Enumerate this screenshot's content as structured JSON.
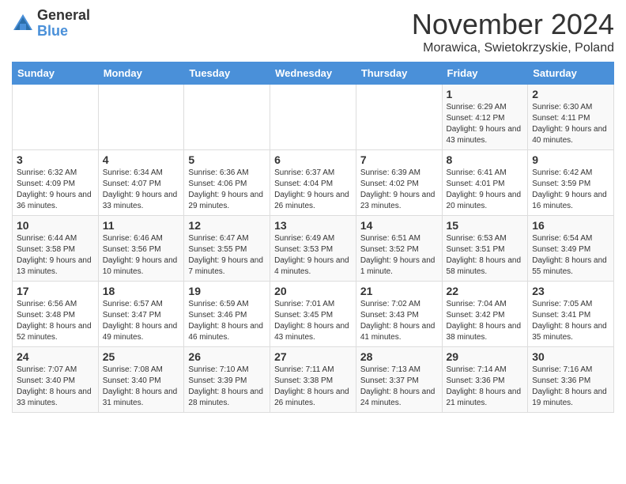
{
  "logo": {
    "general": "General",
    "blue": "Blue"
  },
  "header": {
    "month": "November 2024",
    "location": "Morawica, Swietokrzyskie, Poland"
  },
  "weekdays": [
    "Sunday",
    "Monday",
    "Tuesday",
    "Wednesday",
    "Thursday",
    "Friday",
    "Saturday"
  ],
  "weeks": [
    [
      {
        "day": "",
        "sunrise": "",
        "sunset": "",
        "daylight": ""
      },
      {
        "day": "",
        "sunrise": "",
        "sunset": "",
        "daylight": ""
      },
      {
        "day": "",
        "sunrise": "",
        "sunset": "",
        "daylight": ""
      },
      {
        "day": "",
        "sunrise": "",
        "sunset": "",
        "daylight": ""
      },
      {
        "day": "",
        "sunrise": "",
        "sunset": "",
        "daylight": ""
      },
      {
        "day": "1",
        "sunrise": "Sunrise: 6:29 AM",
        "sunset": "Sunset: 4:12 PM",
        "daylight": "Daylight: 9 hours and 43 minutes."
      },
      {
        "day": "2",
        "sunrise": "Sunrise: 6:30 AM",
        "sunset": "Sunset: 4:11 PM",
        "daylight": "Daylight: 9 hours and 40 minutes."
      }
    ],
    [
      {
        "day": "3",
        "sunrise": "Sunrise: 6:32 AM",
        "sunset": "Sunset: 4:09 PM",
        "daylight": "Daylight: 9 hours and 36 minutes."
      },
      {
        "day": "4",
        "sunrise": "Sunrise: 6:34 AM",
        "sunset": "Sunset: 4:07 PM",
        "daylight": "Daylight: 9 hours and 33 minutes."
      },
      {
        "day": "5",
        "sunrise": "Sunrise: 6:36 AM",
        "sunset": "Sunset: 4:06 PM",
        "daylight": "Daylight: 9 hours and 29 minutes."
      },
      {
        "day": "6",
        "sunrise": "Sunrise: 6:37 AM",
        "sunset": "Sunset: 4:04 PM",
        "daylight": "Daylight: 9 hours and 26 minutes."
      },
      {
        "day": "7",
        "sunrise": "Sunrise: 6:39 AM",
        "sunset": "Sunset: 4:02 PM",
        "daylight": "Daylight: 9 hours and 23 minutes."
      },
      {
        "day": "8",
        "sunrise": "Sunrise: 6:41 AM",
        "sunset": "Sunset: 4:01 PM",
        "daylight": "Daylight: 9 hours and 20 minutes."
      },
      {
        "day": "9",
        "sunrise": "Sunrise: 6:42 AM",
        "sunset": "Sunset: 3:59 PM",
        "daylight": "Daylight: 9 hours and 16 minutes."
      }
    ],
    [
      {
        "day": "10",
        "sunrise": "Sunrise: 6:44 AM",
        "sunset": "Sunset: 3:58 PM",
        "daylight": "Daylight: 9 hours and 13 minutes."
      },
      {
        "day": "11",
        "sunrise": "Sunrise: 6:46 AM",
        "sunset": "Sunset: 3:56 PM",
        "daylight": "Daylight: 9 hours and 10 minutes."
      },
      {
        "day": "12",
        "sunrise": "Sunrise: 6:47 AM",
        "sunset": "Sunset: 3:55 PM",
        "daylight": "Daylight: 9 hours and 7 minutes."
      },
      {
        "day": "13",
        "sunrise": "Sunrise: 6:49 AM",
        "sunset": "Sunset: 3:53 PM",
        "daylight": "Daylight: 9 hours and 4 minutes."
      },
      {
        "day": "14",
        "sunrise": "Sunrise: 6:51 AM",
        "sunset": "Sunset: 3:52 PM",
        "daylight": "Daylight: 9 hours and 1 minute."
      },
      {
        "day": "15",
        "sunrise": "Sunrise: 6:53 AM",
        "sunset": "Sunset: 3:51 PM",
        "daylight": "Daylight: 8 hours and 58 minutes."
      },
      {
        "day": "16",
        "sunrise": "Sunrise: 6:54 AM",
        "sunset": "Sunset: 3:49 PM",
        "daylight": "Daylight: 8 hours and 55 minutes."
      }
    ],
    [
      {
        "day": "17",
        "sunrise": "Sunrise: 6:56 AM",
        "sunset": "Sunset: 3:48 PM",
        "daylight": "Daylight: 8 hours and 52 minutes."
      },
      {
        "day": "18",
        "sunrise": "Sunrise: 6:57 AM",
        "sunset": "Sunset: 3:47 PM",
        "daylight": "Daylight: 8 hours and 49 minutes."
      },
      {
        "day": "19",
        "sunrise": "Sunrise: 6:59 AM",
        "sunset": "Sunset: 3:46 PM",
        "daylight": "Daylight: 8 hours and 46 minutes."
      },
      {
        "day": "20",
        "sunrise": "Sunrise: 7:01 AM",
        "sunset": "Sunset: 3:45 PM",
        "daylight": "Daylight: 8 hours and 43 minutes."
      },
      {
        "day": "21",
        "sunrise": "Sunrise: 7:02 AM",
        "sunset": "Sunset: 3:43 PM",
        "daylight": "Daylight: 8 hours and 41 minutes."
      },
      {
        "day": "22",
        "sunrise": "Sunrise: 7:04 AM",
        "sunset": "Sunset: 3:42 PM",
        "daylight": "Daylight: 8 hours and 38 minutes."
      },
      {
        "day": "23",
        "sunrise": "Sunrise: 7:05 AM",
        "sunset": "Sunset: 3:41 PM",
        "daylight": "Daylight: 8 hours and 35 minutes."
      }
    ],
    [
      {
        "day": "24",
        "sunrise": "Sunrise: 7:07 AM",
        "sunset": "Sunset: 3:40 PM",
        "daylight": "Daylight: 8 hours and 33 minutes."
      },
      {
        "day": "25",
        "sunrise": "Sunrise: 7:08 AM",
        "sunset": "Sunset: 3:40 PM",
        "daylight": "Daylight: 8 hours and 31 minutes."
      },
      {
        "day": "26",
        "sunrise": "Sunrise: 7:10 AM",
        "sunset": "Sunset: 3:39 PM",
        "daylight": "Daylight: 8 hours and 28 minutes."
      },
      {
        "day": "27",
        "sunrise": "Sunrise: 7:11 AM",
        "sunset": "Sunset: 3:38 PM",
        "daylight": "Daylight: 8 hours and 26 minutes."
      },
      {
        "day": "28",
        "sunrise": "Sunrise: 7:13 AM",
        "sunset": "Sunset: 3:37 PM",
        "daylight": "Daylight: 8 hours and 24 minutes."
      },
      {
        "day": "29",
        "sunrise": "Sunrise: 7:14 AM",
        "sunset": "Sunset: 3:36 PM",
        "daylight": "Daylight: 8 hours and 21 minutes."
      },
      {
        "day": "30",
        "sunrise": "Sunrise: 7:16 AM",
        "sunset": "Sunset: 3:36 PM",
        "daylight": "Daylight: 8 hours and 19 minutes."
      }
    ]
  ]
}
